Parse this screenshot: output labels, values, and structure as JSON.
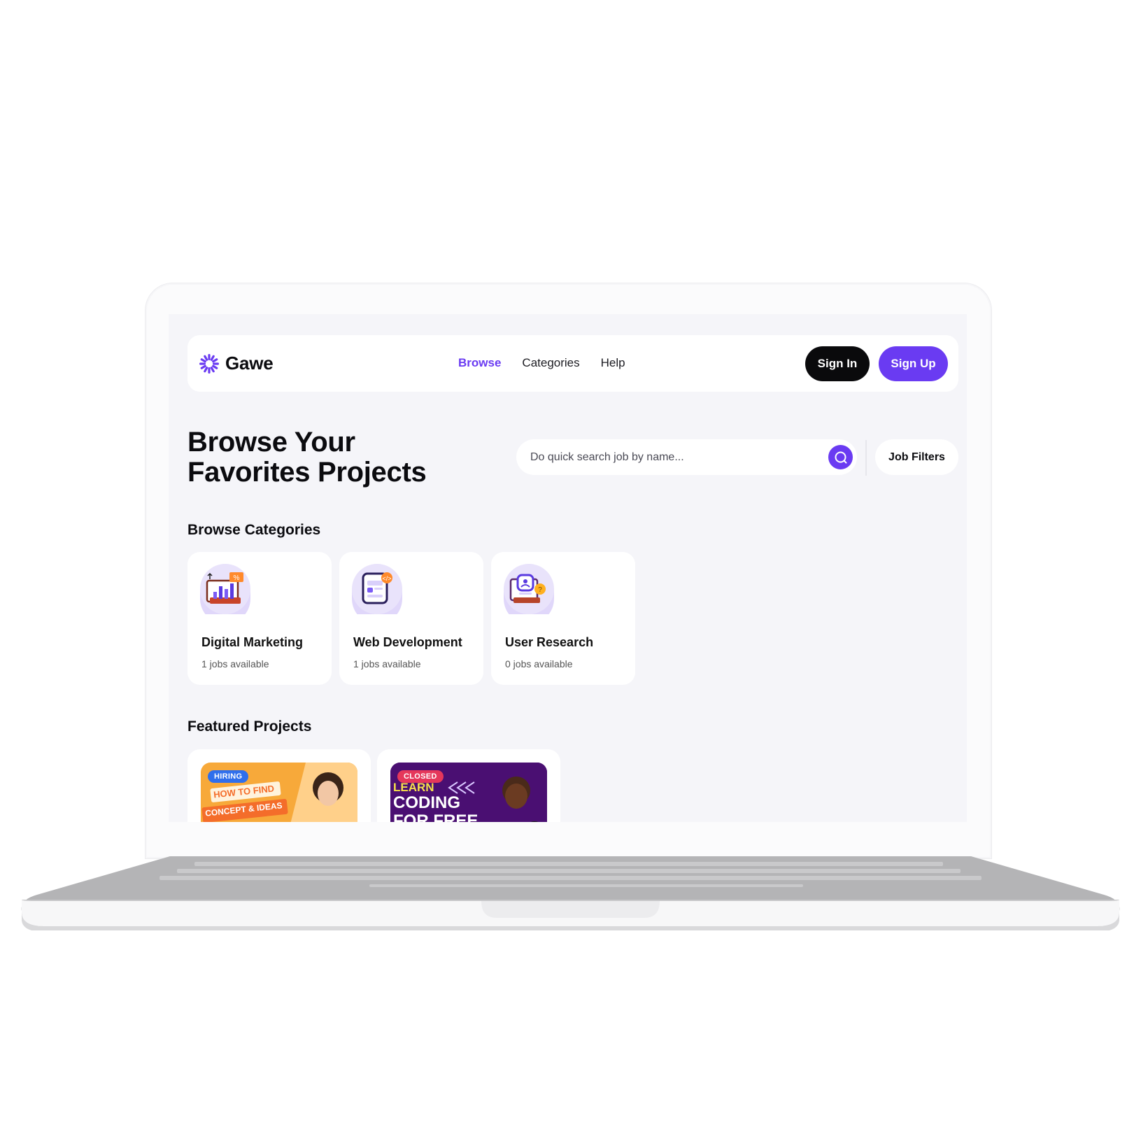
{
  "brand": {
    "name": "Gawe",
    "accent": "#6a3bf2"
  },
  "nav": {
    "links": [
      {
        "label": "Browse",
        "active": true
      },
      {
        "label": "Categories",
        "active": false
      },
      {
        "label": "Help",
        "active": false
      }
    ],
    "sign_in": "Sign In",
    "sign_up": "Sign Up"
  },
  "hero": {
    "title_line1": "Browse Your",
    "title_line2": "Favorites Projects",
    "search_placeholder": "Do quick search job by name...",
    "filter_label": "Job Filters"
  },
  "categories": {
    "heading": "Browse Categories",
    "items": [
      {
        "name": "Digital Marketing",
        "count": "1 jobs available",
        "icon": "marketing-chart-icon"
      },
      {
        "name": "Web Development",
        "count": "1 jobs available",
        "icon": "web-dev-phone-icon"
      },
      {
        "name": "User Research",
        "count": "0 jobs available",
        "icon": "user-research-icon"
      }
    ]
  },
  "featured": {
    "heading": "Featured Projects",
    "items": [
      {
        "badge": "HIRING",
        "badge_color": "#2f6fec",
        "thumb_line1": "HOW TO FIND",
        "thumb_line2": "CONCEPT & IDEAS"
      },
      {
        "badge": "CLOSED",
        "badge_color": "#e5375b",
        "thumb_line1": "LEARN",
        "thumb_line2": "CODING",
        "thumb_line3": "FOR FREE"
      }
    ]
  }
}
